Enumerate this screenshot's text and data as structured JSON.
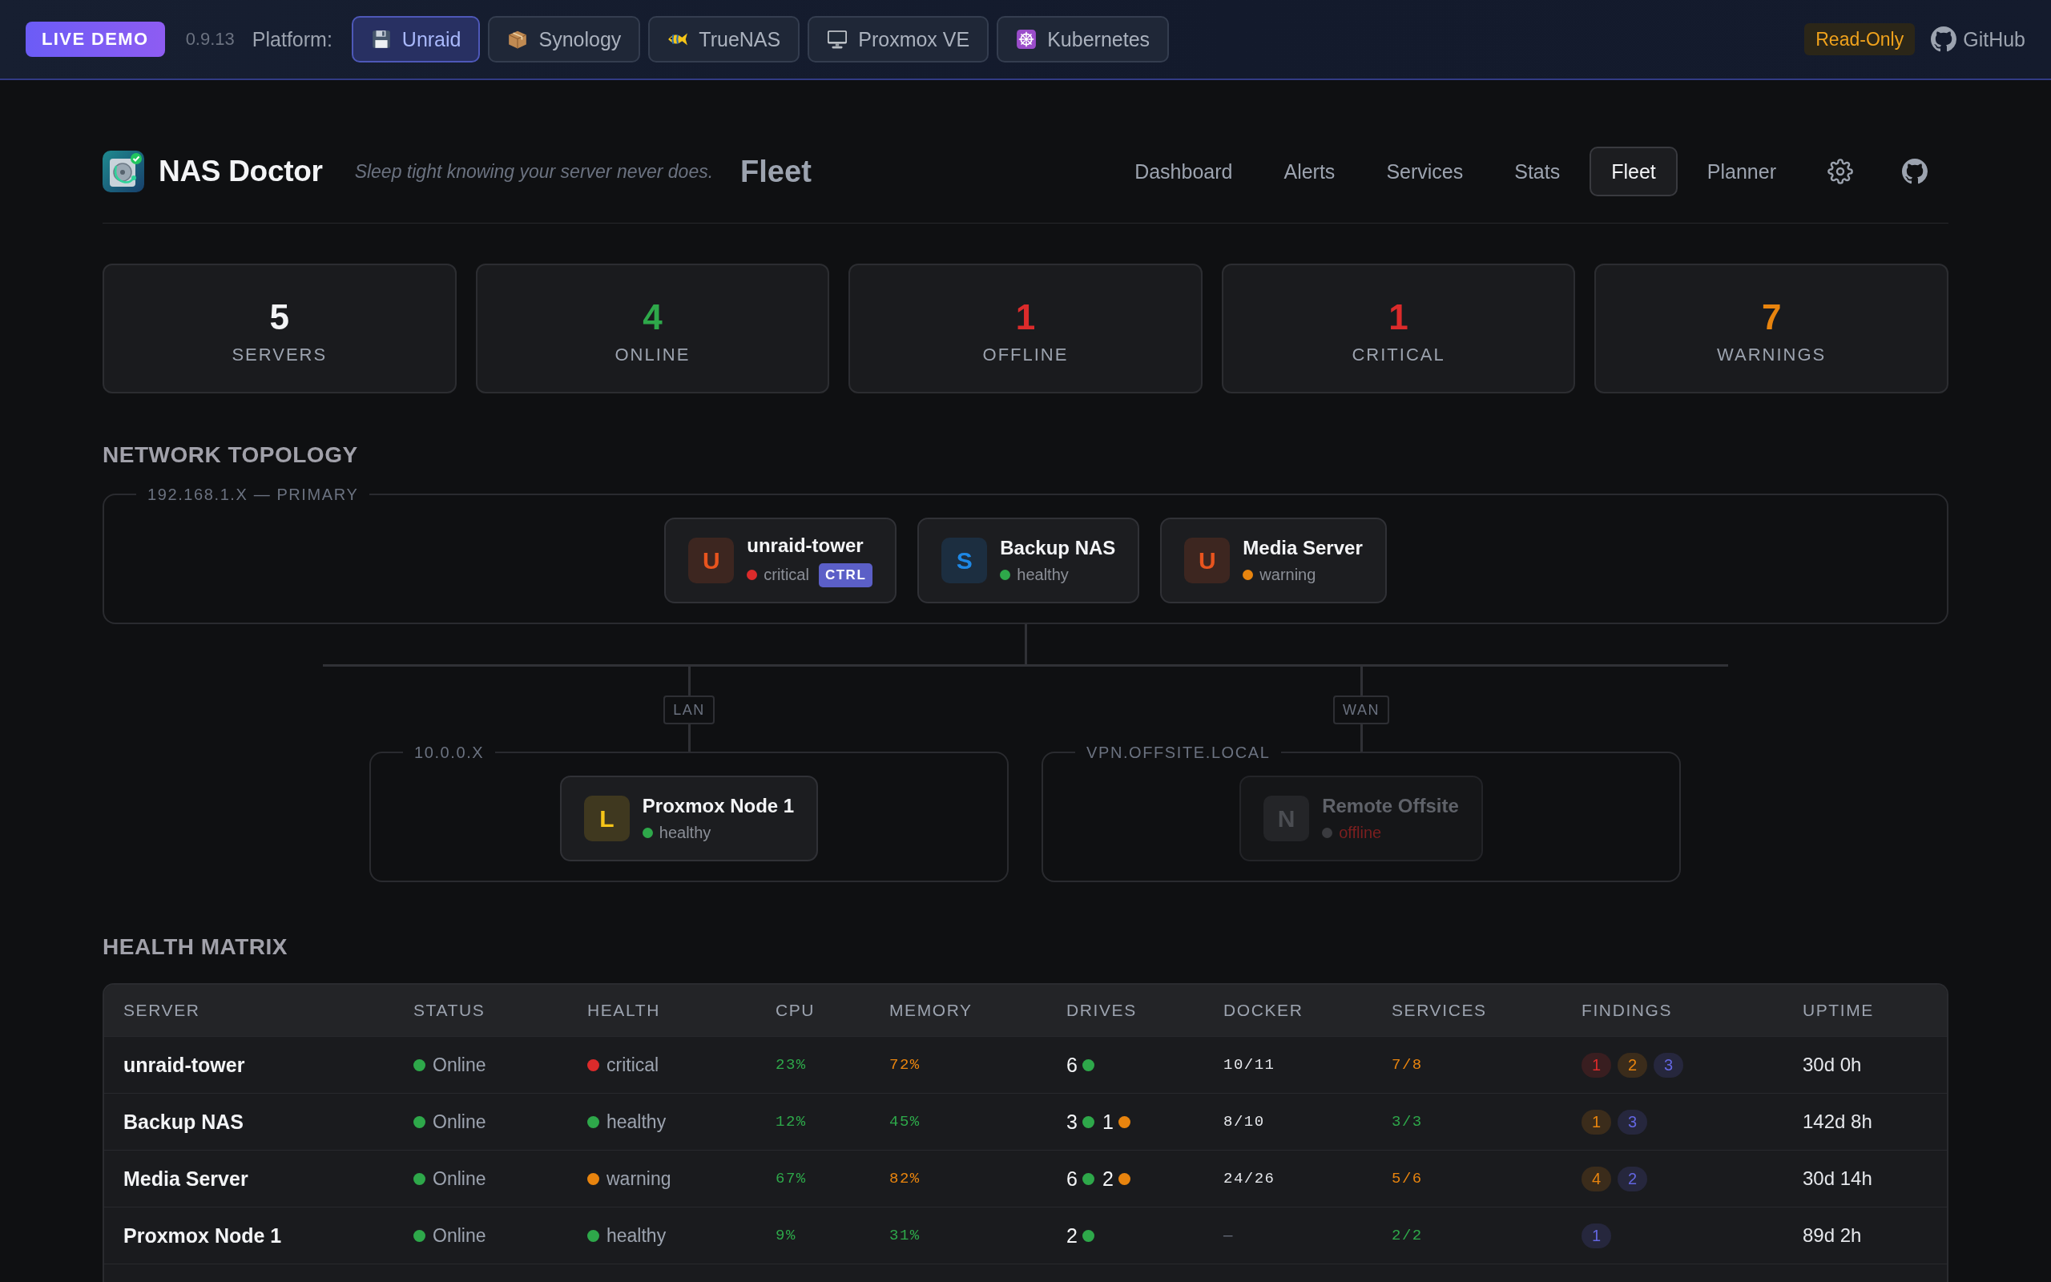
{
  "demo_bar": {
    "badge": "LIVE DEMO",
    "version": "0.9.13",
    "platform_label": "Platform:",
    "platforms": [
      {
        "label": "Unraid",
        "selected": true
      },
      {
        "label": "Synology",
        "selected": false
      },
      {
        "label": "TrueNAS",
        "selected": false
      },
      {
        "label": "Proxmox VE",
        "selected": false
      },
      {
        "label": "Kubernetes",
        "selected": false
      }
    ],
    "mode_badge": "Read-Only",
    "repo_link": "GitHub"
  },
  "header": {
    "app_name": "NAS Doctor",
    "tagline": "Sleep tight knowing your server never does.",
    "page_title": "Fleet",
    "nav": [
      {
        "label": "Dashboard",
        "selected": false
      },
      {
        "label": "Alerts",
        "selected": false
      },
      {
        "label": "Services",
        "selected": false
      },
      {
        "label": "Stats",
        "selected": false
      },
      {
        "label": "Fleet",
        "selected": true
      },
      {
        "label": "Planner",
        "selected": false
      }
    ]
  },
  "stats": [
    {
      "value": "5",
      "label": "SERVERS",
      "color": "#f3f4f6"
    },
    {
      "value": "4",
      "label": "ONLINE",
      "color": "#2ea84a"
    },
    {
      "value": "1",
      "label": "OFFLINE",
      "color": "#dc2b2b"
    },
    {
      "value": "1",
      "label": "CRITICAL",
      "color": "#dc2b2b"
    },
    {
      "value": "7",
      "label": "WARNINGS",
      "color": "#e8840e"
    }
  ],
  "topology": {
    "title": "NETWORK TOPOLOGY",
    "primary": {
      "label": "192.168.1.X — PRIMARY",
      "nodes": [
        {
          "avatar": {
            "letter": "U",
            "color": "#e8541e"
          },
          "name": "unraid-tower",
          "offline": false,
          "status": {
            "label": "critical",
            "color": "#dc2b2b"
          },
          "badge": "CTRL"
        },
        {
          "avatar": {
            "letter": "S",
            "color": "#1e88e5"
          },
          "name": "Backup NAS",
          "offline": false,
          "status": {
            "label": "healthy",
            "color": "#2ea84a"
          }
        },
        {
          "avatar": {
            "letter": "U",
            "color": "#e8541e"
          },
          "name": "Media Server",
          "offline": false,
          "status": {
            "label": "warning",
            "color": "#e8840e"
          }
        }
      ]
    },
    "links": [
      {
        "label": "LAN",
        "group": {
          "label": "10.0.0.X",
          "nodes": [
            {
              "avatar": {
                "letter": "L",
                "color": "#f5c518"
              },
              "name": "Proxmox Node 1",
              "offline": false,
              "status": {
                "label": "healthy",
                "color": "#2ea84a"
              }
            }
          ]
        }
      },
      {
        "label": "WAN",
        "group": {
          "label": "VPN.OFFSITE.LOCAL",
          "nodes": [
            {
              "avatar": {
                "letter": "N",
                "color": "#4b4d52"
              },
              "name": "Remote Offsite",
              "offline": true,
              "status": {
                "label": "offline",
                "color": "#3a3b3f"
              }
            }
          ]
        }
      }
    ]
  },
  "health_matrix": {
    "title": "HEALTH MATRIX",
    "columns": [
      "SERVER",
      "STATUS",
      "HEALTH",
      "CPU",
      "MEMORY",
      "DRIVES",
      "DOCKER",
      "SERVICES",
      "FINDINGS",
      "UPTIME"
    ],
    "rows": [
      {
        "server": "unraid-tower",
        "status": {
          "label": "Online",
          "color": "#2ea84a"
        },
        "health": {
          "label": "critical",
          "color": "#dc2b2b"
        },
        "cpu": {
          "value": "23%",
          "color": "#2ea84a"
        },
        "memory": {
          "value": "72%",
          "color": "#e8840e"
        },
        "drives": [
          {
            "count": "6",
            "color": "#2ea84a"
          }
        ],
        "docker": {
          "value": "10/11",
          "color": "#e5e7eb"
        },
        "services": {
          "value": "7/8",
          "color": "#e8840e"
        },
        "findings": [
          {
            "count": "1",
            "color": "#dc2b2b"
          },
          {
            "count": "2",
            "color": "#e8840e"
          },
          {
            "count": "3",
            "color": "#6366e0"
          }
        ],
        "uptime": "30d 0h"
      },
      {
        "server": "Backup NAS",
        "status": {
          "label": "Online",
          "color": "#2ea84a"
        },
        "health": {
          "label": "healthy",
          "color": "#2ea84a"
        },
        "cpu": {
          "value": "12%",
          "color": "#2ea84a"
        },
        "memory": {
          "value": "45%",
          "color": "#2ea84a"
        },
        "drives": [
          {
            "count": "3",
            "color": "#2ea84a"
          },
          {
            "count": "1",
            "color": "#e8840e"
          }
        ],
        "docker": {
          "value": "8/10",
          "color": "#e5e7eb"
        },
        "services": {
          "value": "3/3",
          "color": "#2ea84a"
        },
        "findings": [
          {
            "count": "1",
            "color": "#e8840e"
          },
          {
            "count": "3",
            "color": "#6366e0"
          }
        ],
        "uptime": "142d 8h"
      },
      {
        "server": "Media Server",
        "status": {
          "label": "Online",
          "color": "#2ea84a"
        },
        "health": {
          "label": "warning",
          "color": "#e8840e"
        },
        "cpu": {
          "value": "67%",
          "color": "#2ea84a"
        },
        "memory": {
          "value": "82%",
          "color": "#e8840e"
        },
        "drives": [
          {
            "count": "6",
            "color": "#2ea84a"
          },
          {
            "count": "2",
            "color": "#e8840e"
          }
        ],
        "docker": {
          "value": "24/26",
          "color": "#e5e7eb"
        },
        "services": {
          "value": "5/6",
          "color": "#e8840e"
        },
        "findings": [
          {
            "count": "4",
            "color": "#e8840e"
          },
          {
            "count": "2",
            "color": "#6366e0"
          }
        ],
        "uptime": "30d 14h"
      },
      {
        "server": "Proxmox Node 1",
        "status": {
          "label": "Online",
          "color": "#2ea84a"
        },
        "health": {
          "label": "healthy",
          "color": "#2ea84a"
        },
        "cpu": {
          "value": "9%",
          "color": "#2ea84a"
        },
        "memory": {
          "value": "31%",
          "color": "#2ea84a"
        },
        "drives": [
          {
            "count": "2",
            "color": "#2ea84a"
          }
        ],
        "docker": {
          "value": "—",
          "color": "#6b7280"
        },
        "services": {
          "value": "2/2",
          "color": "#2ea84a"
        },
        "findings": [
          {
            "count": "1",
            "color": "#6366e0"
          }
        ],
        "uptime": "89d 2h"
      }
    ]
  }
}
